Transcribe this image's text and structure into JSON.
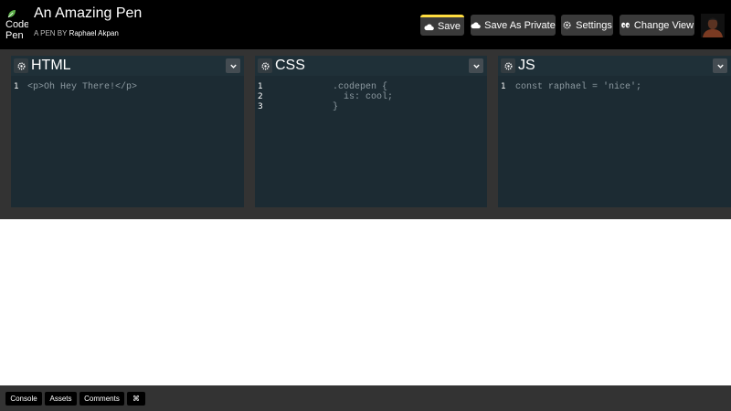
{
  "header": {
    "logo": {
      "line1": "Code",
      "line2": "Pen"
    },
    "title": "An Amazing Pen",
    "byline_prefix": "A PEN BY",
    "author": "Raphael Akpan",
    "buttons": {
      "save": "Save",
      "save_private": "Save As Private",
      "settings": "Settings",
      "change_view": "Change View"
    }
  },
  "panels": {
    "html": {
      "title": "HTML",
      "lines": [
        {
          "num": "1",
          "text": "<p>Oh Hey There!</p>"
        }
      ]
    },
    "css": {
      "title": "CSS",
      "lines": [
        {
          "num": "1",
          "text": ".codepen {"
        },
        {
          "num": "2",
          "text": "  is: cool;"
        },
        {
          "num": "3",
          "text": "}"
        }
      ]
    },
    "js": {
      "title": "JS",
      "lines": [
        {
          "num": "1",
          "text": "const raphael = 'nice';"
        }
      ]
    }
  },
  "footer": {
    "console": "Console",
    "assets": "Assets",
    "comments": "Comments",
    "shortcuts": "⌘"
  },
  "icons": {
    "logo": "codepen-leaf-icon",
    "save": "cloud-icon",
    "save_private": "cloud-icon",
    "settings": "gear-icon",
    "change_view": "eyes-icon",
    "panel_settings": "gear-icon",
    "panel_collapse": "chevron-down-icon"
  },
  "colors": {
    "header_bg": "#000000",
    "editor_area_bg": "#333333",
    "panel_bg": "#1c2b33",
    "save_accent": "#ffdd40",
    "code_text": "#8d9aa1"
  }
}
